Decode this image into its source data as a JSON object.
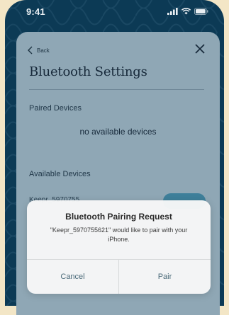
{
  "status_bar": {
    "time": "9:41",
    "icons": [
      "signal-icon",
      "wifi-icon",
      "battery-icon"
    ]
  },
  "header": {
    "back_label": "Back",
    "title": "Bluetooth Settings"
  },
  "paired": {
    "label": "Paired Devices",
    "empty_text": "no available devices"
  },
  "available": {
    "label": "Available Devices",
    "device_name": "Keepr_5970755"
  },
  "alert": {
    "title": "Bluetooth Pairing Request",
    "message": "\"Keepr_5970755621\" would like to pair with your iPhone.",
    "cancel_label": "Cancel",
    "pair_label": "Pair"
  },
  "colors": {
    "background": "#f3e6c6",
    "phone": "#0c3a55",
    "screen": "#8fa7b5",
    "accent": "#3e7f9a"
  }
}
